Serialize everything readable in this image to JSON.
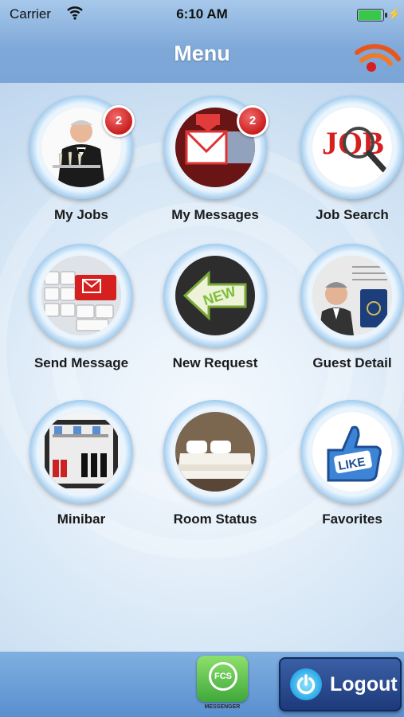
{
  "status_bar": {
    "carrier": "Carrier",
    "time": "6:10 AM",
    "battery_level": 1.0
  },
  "header": {
    "title": "Menu",
    "rss_icon": "rss-feed-icon"
  },
  "menu": [
    {
      "id": "my-jobs",
      "label": "My Jobs",
      "icon": "waiter-icon",
      "badge": "2"
    },
    {
      "id": "my-messages",
      "label": "My Messages",
      "icon": "envelope-icon",
      "badge": "2"
    },
    {
      "id": "job-search",
      "label": "Job Search",
      "icon": "job-magnifier-icon",
      "badge": ""
    },
    {
      "id": "send-message",
      "label": "Send Message",
      "icon": "keyboard-envelope-icon",
      "badge": ""
    },
    {
      "id": "new-request",
      "label": "New Request",
      "icon": "new-arrow-icon",
      "badge": ""
    },
    {
      "id": "guest-detail",
      "label": "Guest Detail",
      "icon": "guest-passport-icon",
      "badge": ""
    },
    {
      "id": "minibar",
      "label": "Minibar",
      "icon": "minibar-fridge-icon",
      "badge": ""
    },
    {
      "id": "room-status",
      "label": "Room Status",
      "icon": "bed-icon",
      "badge": ""
    },
    {
      "id": "favorites",
      "label": "Favorites",
      "icon": "like-thumb-icon",
      "badge": ""
    }
  ],
  "bottom_bar": {
    "fcs_logo_text": "FCS",
    "fcs_caption": "MESSENGER",
    "logout_label": "Logout"
  },
  "colors": {
    "header": "#7ea8d8",
    "badge": "#d42a2a",
    "logout": "#1d3a7a",
    "fcs_green": "#4fb43f"
  }
}
